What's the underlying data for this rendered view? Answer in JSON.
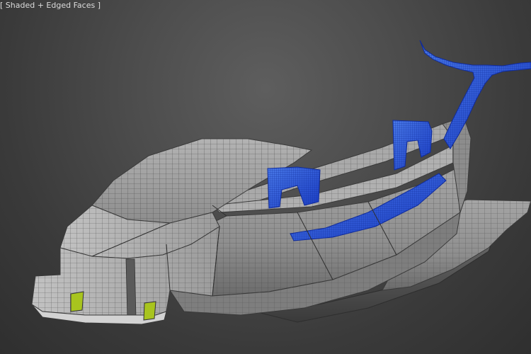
{
  "viewport": {
    "label": "[ Shaded + Edged Faces ]"
  },
  "colors": {
    "background": "#4a4a4a",
    "hull": "#9a9a9a",
    "hull_light": "#b9b9b9",
    "hull_dark": "#6e6e6e",
    "edges": "#3d3d3d",
    "selection": "#2a55d6",
    "selection_wire": "#1030a8",
    "lights": "#a8c41e"
  },
  "icons": {
    "model": "spaceship-hull-mesh",
    "fin": "selected-tail-fin-mesh",
    "bracket_front": "selected-front-bracket-mesh",
    "bracket_rear": "selected-rear-bracket-mesh",
    "trough": "selected-cockpit-trough-mesh",
    "headlights": "headlight-patches"
  }
}
